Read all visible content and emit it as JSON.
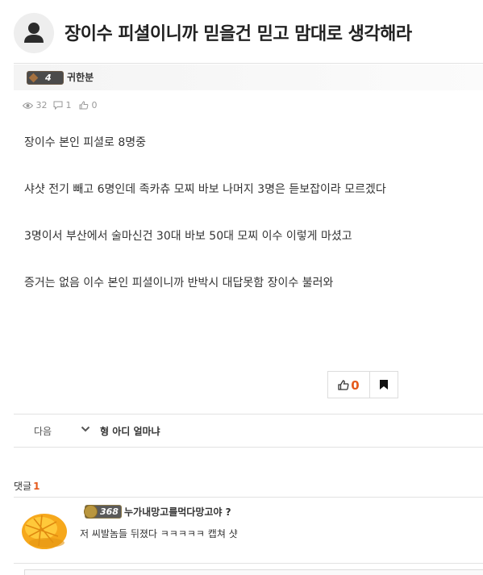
{
  "post": {
    "title": "장이수 피셜이니까 믿을건 믿고 맘대로 생각해라",
    "author": {
      "level": "4",
      "name": "귀한분"
    },
    "stats": {
      "views": "32",
      "comments": "1",
      "likes": "0"
    },
    "body": [
      "장이수 본인 피셜로 8명중",
      "샤샷 전기 빼고 6명인데 족카츄 모찌 바보 나머지 3명은 듣보잡이라 모르겠다",
      "3명이서 부산에서 술마신건 30대 바보 50대 모찌 이수 이렇게 마셨고",
      "증거는 없음 이수 본인 피셜이니까 반박시 대답못함 장이수 불러와"
    ],
    "vote": {
      "like_count": "0"
    }
  },
  "nav": {
    "next_label": "다음",
    "next_title": "형 아디 얼마냐"
  },
  "comments": {
    "label": "댓글",
    "count": "1",
    "items": [
      {
        "level": "368",
        "author": "누가내망고를먹다망고야 ?",
        "text": "저 씨발놈들 뒤졌다 ㅋㅋㅋㅋㅋ 캡쳐 샷"
      }
    ]
  },
  "colors": {
    "accent": "#e55a1c",
    "divider": "#e2e2e2"
  },
  "icons": [
    "user-icon",
    "eye-icon",
    "comment-icon",
    "thumbs-up-icon",
    "bookmark-icon",
    "chevron-down-icon"
  ]
}
